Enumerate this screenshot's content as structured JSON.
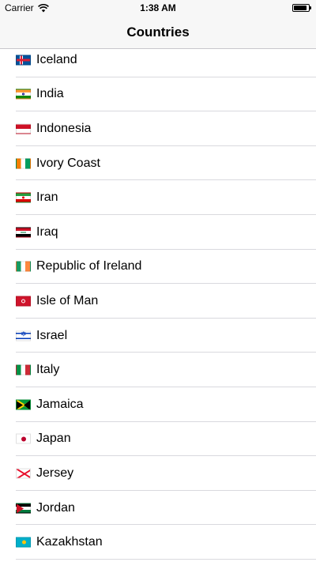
{
  "status_bar": {
    "carrier": "Carrier",
    "time": "1:38 AM"
  },
  "nav": {
    "title": "Countries"
  },
  "countries": [
    {
      "name": "Iceland",
      "flag": "iceland-flag-icon"
    },
    {
      "name": "India",
      "flag": "india-flag-icon"
    },
    {
      "name": "Indonesia",
      "flag": "indonesia-flag-icon"
    },
    {
      "name": "Ivory Coast",
      "flag": "ivory-coast-flag-icon"
    },
    {
      "name": "Iran",
      "flag": "iran-flag-icon"
    },
    {
      "name": "Iraq",
      "flag": "iraq-flag-icon"
    },
    {
      "name": "Republic of Ireland",
      "flag": "ireland-flag-icon"
    },
    {
      "name": "Isle of Man",
      "flag": "isle-of-man-flag-icon"
    },
    {
      "name": "Israel",
      "flag": "israel-flag-icon"
    },
    {
      "name": "Italy",
      "flag": "italy-flag-icon"
    },
    {
      "name": "Jamaica",
      "flag": "jamaica-flag-icon"
    },
    {
      "name": "Japan",
      "flag": "japan-flag-icon"
    },
    {
      "name": "Jersey",
      "flag": "jersey-flag-icon"
    },
    {
      "name": "Jordan",
      "flag": "jordan-flag-icon"
    },
    {
      "name": "Kazakhstan",
      "flag": "kazakhstan-flag-icon"
    }
  ]
}
